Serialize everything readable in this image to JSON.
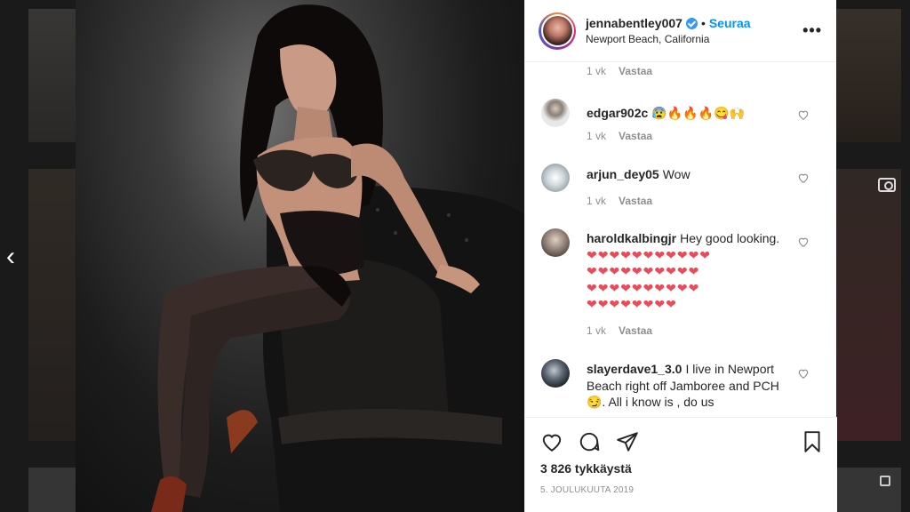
{
  "post": {
    "username": "jennabentley007",
    "verified": true,
    "follow_label": "Seuraa",
    "dot": "•",
    "location": "Newport Beach, California",
    "more_icon": "more-horizontal-icon",
    "likes": "3 826 tykkäystä",
    "date": "5. JOULUKUUTA 2019"
  },
  "top_meta": {
    "time": "1 vk",
    "reply": "Vastaa"
  },
  "comments": [
    {
      "user": "edgar902c",
      "text": "😰🔥🔥🔥😋🙌",
      "time": "1 vk",
      "reply": "Vastaa"
    },
    {
      "user": "arjun_dey05",
      "text": "Wow",
      "time": "1 vk",
      "reply": "Vastaa"
    },
    {
      "user": "haroldkalbingjr",
      "text": "Hey good looking.",
      "hearts_line1": "❤❤❤❤❤❤❤❤❤❤❤",
      "hearts_line2": "❤❤❤❤❤❤❤❤❤❤",
      "hearts_line3": "❤❤❤❤❤❤❤❤❤❤",
      "hearts_line4": "❤❤❤❤❤❤❤❤",
      "time": "1 vk",
      "reply": "Vastaa"
    },
    {
      "user": "slayerdave1_3.0",
      "text": "I live in Newport Beach right off Jamboree and PCH😏. All i know is , do us"
    }
  ],
  "colors": {
    "accent": "#0095f6",
    "heart": "#ed4956",
    "muted": "#8e8e8e"
  }
}
